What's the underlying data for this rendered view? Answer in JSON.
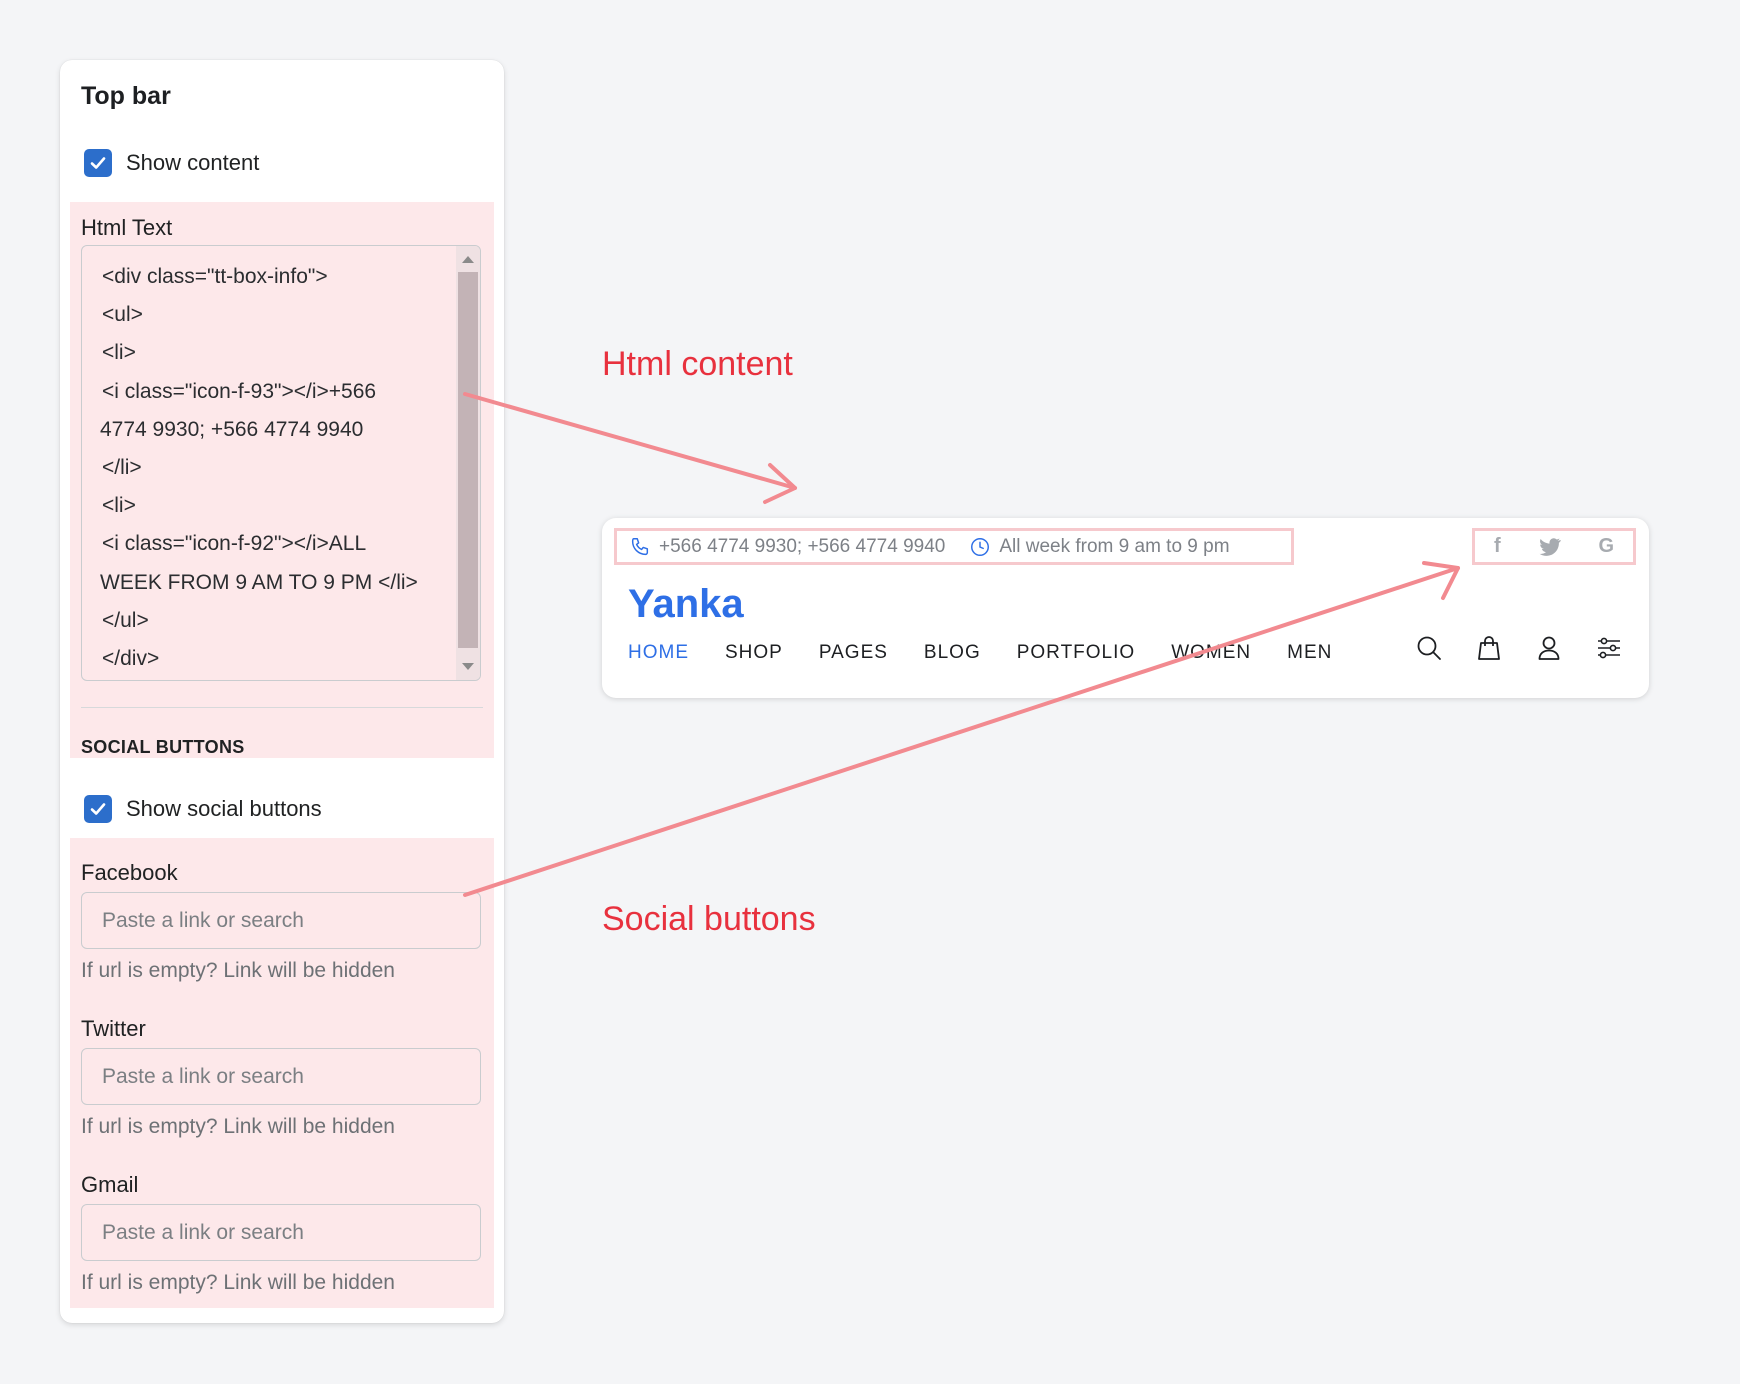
{
  "panel": {
    "title": "Top bar",
    "show_content_label": "Show content",
    "html_text_label": "Html Text",
    "code_lines": [
      "<div class=\"tt-box-info\">",
      "<ul>",
      "<li>",
      "<i class=\"icon-f-93\"></i>+566",
      "4774 9930; +566 4774 9940",
      "</li>",
      "<li>",
      "<i class=\"icon-f-92\"></i>ALL",
      "WEEK FROM 9 AM TO 9 PM </li>",
      "</ul>",
      "</div>"
    ],
    "social_heading": "SOCIAL BUTTONS",
    "show_social_label": "Show social buttons",
    "fields": [
      {
        "label": "Facebook",
        "placeholder": "Paste a link or search",
        "help": "If url is empty? Link will be hidden"
      },
      {
        "label": "Twitter",
        "placeholder": "Paste a link or search",
        "help": "If url is empty? Link will be hidden"
      },
      {
        "label": "Gmail",
        "placeholder": "Paste a link or search",
        "help": "If url is empty? Link will be hidden"
      }
    ]
  },
  "annotations": {
    "html_content": "Html content",
    "social_buttons": "Social buttons"
  },
  "preview": {
    "phone_text": "+566 4774 9930; +566 4774 9940",
    "hours_text": "All week from 9 am to 9 pm",
    "social": [
      "f",
      "twitter-bird",
      "G"
    ],
    "logo": "Yanka",
    "nav": [
      "HOME",
      "SHOP",
      "PAGES",
      "BLOG",
      "PORTFOLIO",
      "WOMEN",
      "MEN"
    ],
    "header_icons": [
      "search-icon",
      "bag-icon",
      "user-icon",
      "sliders-icon"
    ]
  },
  "colors": {
    "accent_blue": "#2e6fe6",
    "annotation_red": "#e8313e",
    "highlight_pink": "#fde8ea",
    "checkbox_blue": "#2c6ecb"
  }
}
